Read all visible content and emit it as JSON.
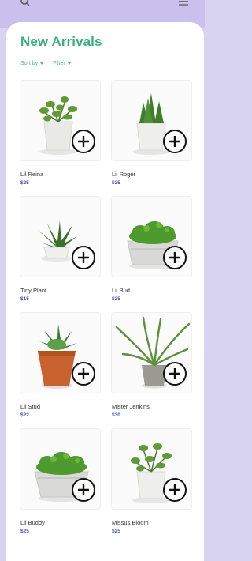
{
  "header": {
    "title": "New Arrivals",
    "sort_label": "Sort by",
    "filter_label": "Filter"
  },
  "colors": {
    "accent": "#37b07e",
    "price": "#4b4fb6",
    "topbar": "#c9c0ee"
  },
  "products": [
    {
      "name": "Lil Reina",
      "price": "$25"
    },
    {
      "name": "Lil Roger",
      "price": "$35"
    },
    {
      "name": "Tiny Plant",
      "price": "$15"
    },
    {
      "name": "Lil Bud",
      "price": "$25"
    },
    {
      "name": "Lil Stud",
      "price": "$22"
    },
    {
      "name": "Mister Jenkins",
      "price": "$30"
    },
    {
      "name": "Lil Buddy",
      "price": "$25"
    },
    {
      "name": "Missus Bloom",
      "price": "$25"
    }
  ]
}
